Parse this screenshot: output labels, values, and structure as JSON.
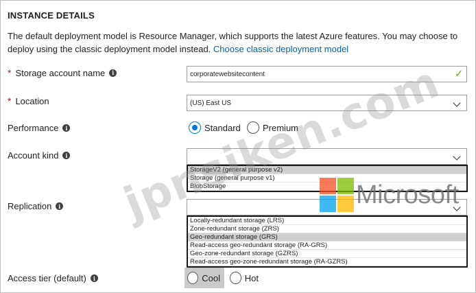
{
  "section": {
    "title": "INSTANCE DETAILS",
    "intro_text": "The default deployment model is Resource Manager, which supports the latest Azure features. You may choose to deploy using the classic deployment model instead.",
    "intro_link": "Choose classic deployment model"
  },
  "fields": {
    "storage_account_name": {
      "label": "Storage account name",
      "value": "corporatewebsitecontent"
    },
    "location": {
      "label": "Location",
      "value": "(US) East US"
    },
    "performance": {
      "label": "Performance",
      "options": [
        "Standard",
        "Premium"
      ],
      "selected": "Standard"
    },
    "account_kind": {
      "label": "Account kind",
      "value": "",
      "options": [
        "StorageV2 (general purpose v2)",
        "Storage (general purpose v1)",
        "BlobStorage"
      ],
      "highlighted": "StorageV2 (general purpose v2)"
    },
    "replication": {
      "label": "Replication",
      "value": "",
      "options": [
        "Locally-redundant storage (LRS)",
        "Zone-redundant storage (ZRS)",
        "Geo-redundant storage (GRS)",
        "Read-access geo-redundant storage (RA-GRS)",
        "Geo-zone-redundant storage (GZRS)",
        "Read-access geo-zone-redundant storage (RA-GZRS)"
      ],
      "highlighted": "Geo-redundant storage (GRS)"
    },
    "access_tier": {
      "label": "Access tier (default)",
      "options": [
        "Cool",
        "Hot"
      ]
    }
  },
  "overlays": {
    "microsoft_wordmark": "Microsoft",
    "watermark": "jpnsiken.com"
  },
  "colors": {
    "link": "#0063b1",
    "radio_selected": "#0078d4",
    "check": "#57a300",
    "ms_red": "#f25022",
    "ms_green": "#7fba00",
    "ms_blue": "#00a4ef",
    "ms_yellow": "#ffb900"
  }
}
